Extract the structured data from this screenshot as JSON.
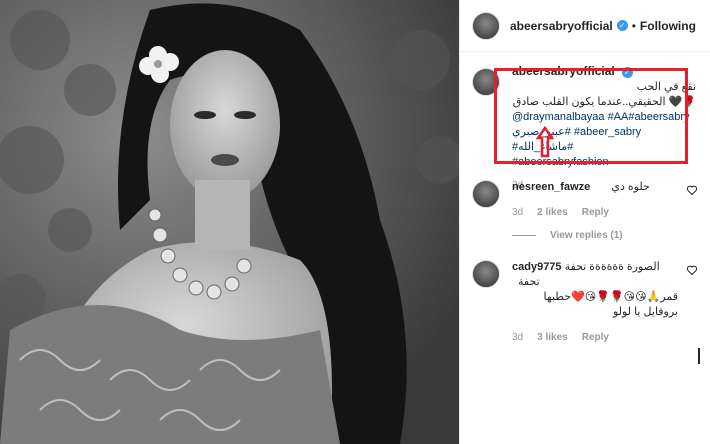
{
  "post": {
    "username": "abeersabryofficial",
    "verified_mark": "✓",
    "dot": "•",
    "follow_status": "Following"
  },
  "caption": {
    "username": "abeersabryofficial",
    "line1": "نقع في الحب",
    "line2": "🌹🖤 الحقيقي..عندما يكون القلب صادق",
    "mention": "@draymanalbayaa",
    "tags_line1": "#AA#abeersabry",
    "tags_line2": "عبير_صبري# #abeer_sabry #ماشاء_الله#",
    "tags_line3": "#abeersabryfashion",
    "time": "3d"
  },
  "comments": [
    {
      "username": "nesreen_fawze",
      "text": "حلوه دي",
      "time": "3d",
      "likes": "2 likes",
      "reply": "Reply"
    },
    {
      "username": "cady9775",
      "text_line1": "الصورة ةةةةةة تحفة تحفة",
      "text_line2": "قمر🙏😘😘🌹🌹😘❤️حطبها",
      "text_line3": "بروفايل يا لولو",
      "time": "3d",
      "likes": "3 likes",
      "reply": "Reply"
    }
  ],
  "view_replies": "View replies (1)",
  "colors": {
    "highlight_box": "#e5202b",
    "verified": "#3897f0",
    "hashtag": "#003569"
  }
}
